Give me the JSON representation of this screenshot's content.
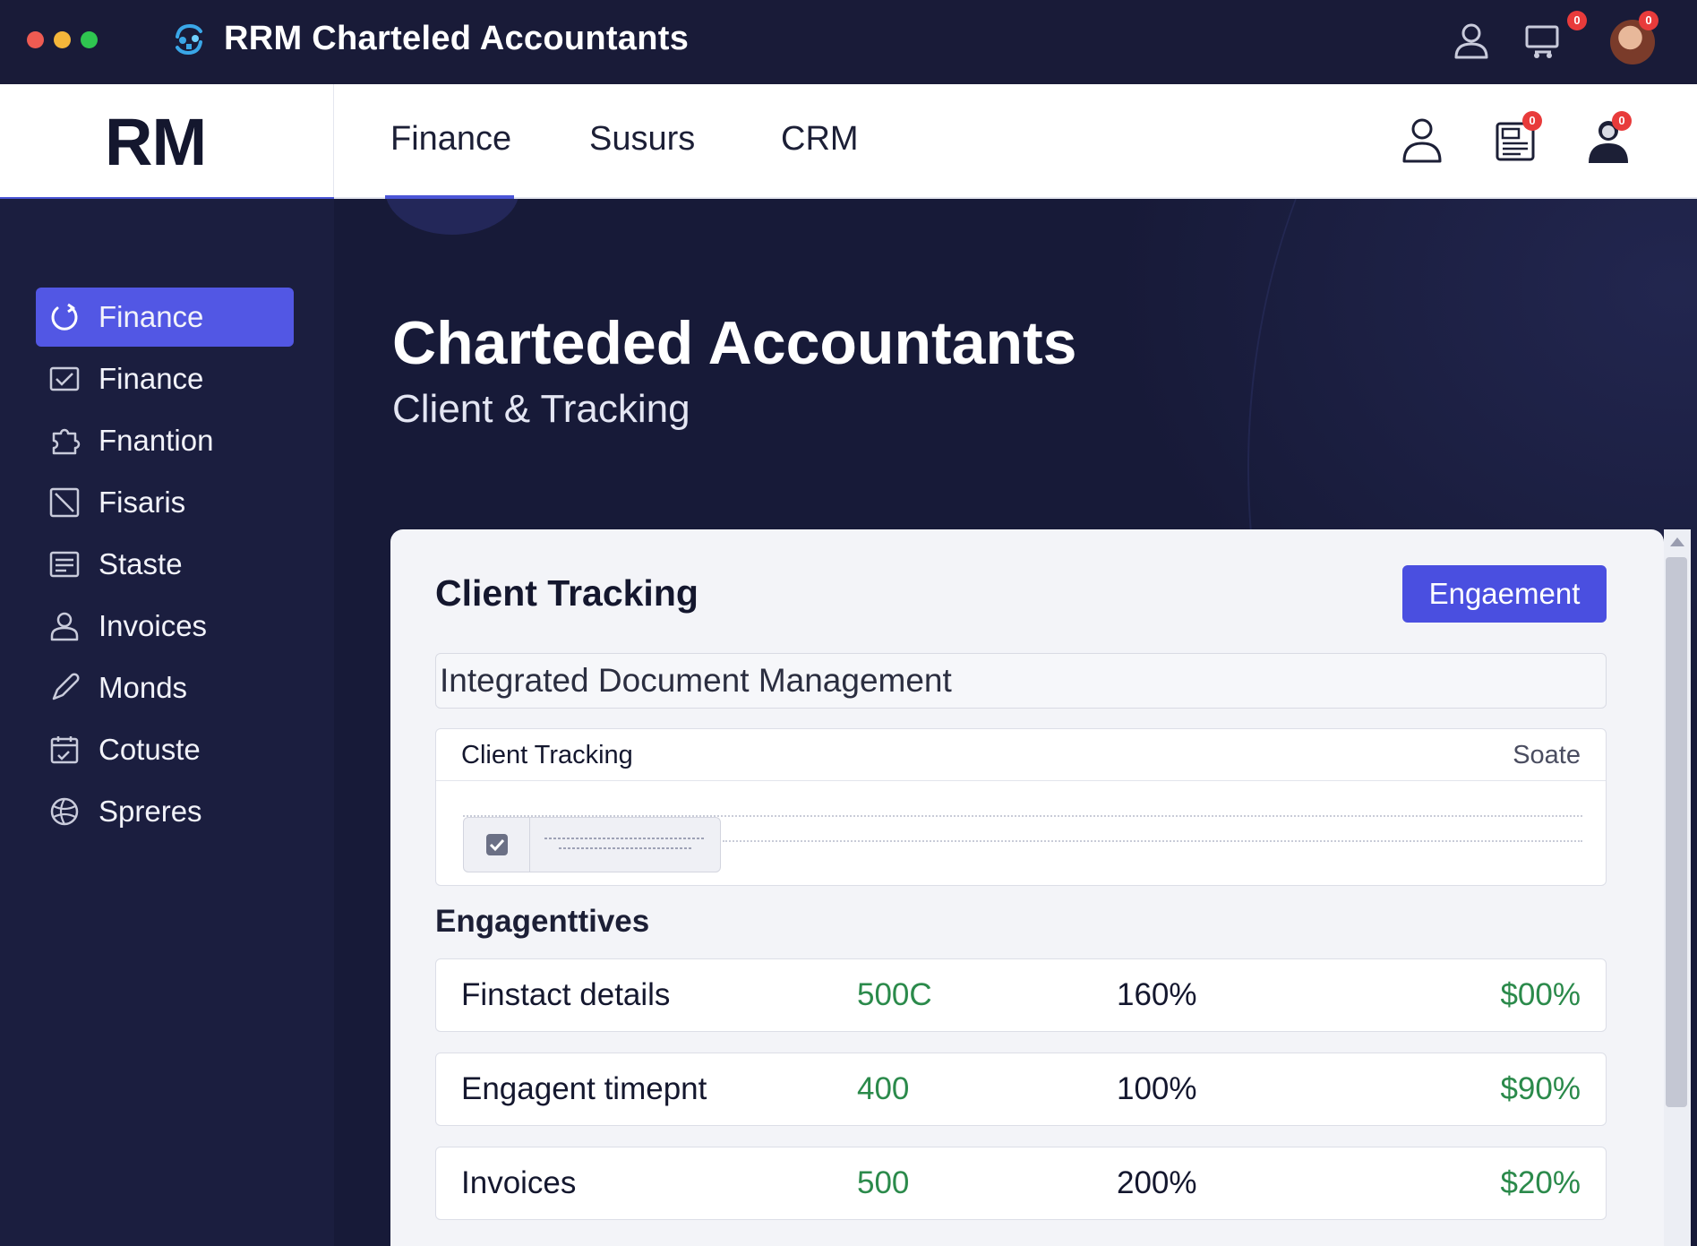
{
  "window": {
    "title": "RRM Charteled Accountants",
    "badges": {
      "cart": "0",
      "avatar": "0"
    }
  },
  "nav": {
    "brand": "RM",
    "tabs": [
      {
        "label": "Finance",
        "active": true
      },
      {
        "label": "Susurs"
      },
      {
        "label": "CRM"
      }
    ],
    "badges": {
      "documents": "0",
      "profile": "0"
    }
  },
  "sidebar": {
    "items": [
      {
        "label": "Finance",
        "icon": "finance-icon",
        "active": true
      },
      {
        "label": "Finance",
        "icon": "mail-check-icon"
      },
      {
        "label": "Fnantion",
        "icon": "puzzle-icon"
      },
      {
        "label": "Fisaris",
        "icon": "chart-box-icon"
      },
      {
        "label": "Staste",
        "icon": "list-box-icon"
      },
      {
        "label": "Invoices",
        "icon": "user-icon"
      },
      {
        "label": "Monds",
        "icon": "pencil-icon"
      },
      {
        "label": "Cotuste",
        "icon": "calendar-icon"
      },
      {
        "label": "Spreres",
        "icon": "globe-icon"
      }
    ]
  },
  "hero": {
    "title": "Charteded Accountants",
    "subtitle": "Client & Tracking"
  },
  "card": {
    "title": "Client Tracking",
    "button_label": "Engaement",
    "search_value": "Integrated Document Management",
    "tracking": {
      "title": "Client Tracking",
      "status": "Soate"
    },
    "section_title": "Engagenttives",
    "rows": [
      {
        "name": "Finstact details",
        "value": "500C",
        "percent": "160%",
        "amount": "$00%"
      },
      {
        "name": "Engagent timepnt",
        "value": "400",
        "percent": "100%",
        "amount": "$90%"
      },
      {
        "name": "Invoices",
        "value": "500",
        "percent": "200%",
        "amount": "$20%"
      }
    ]
  },
  "colors": {
    "accent": "#4a4fe0",
    "sidebar_bg": "#1b1e3f",
    "main_bg": "#171a38",
    "positive": "#2b8a4b",
    "badge": "#e83b3b"
  }
}
